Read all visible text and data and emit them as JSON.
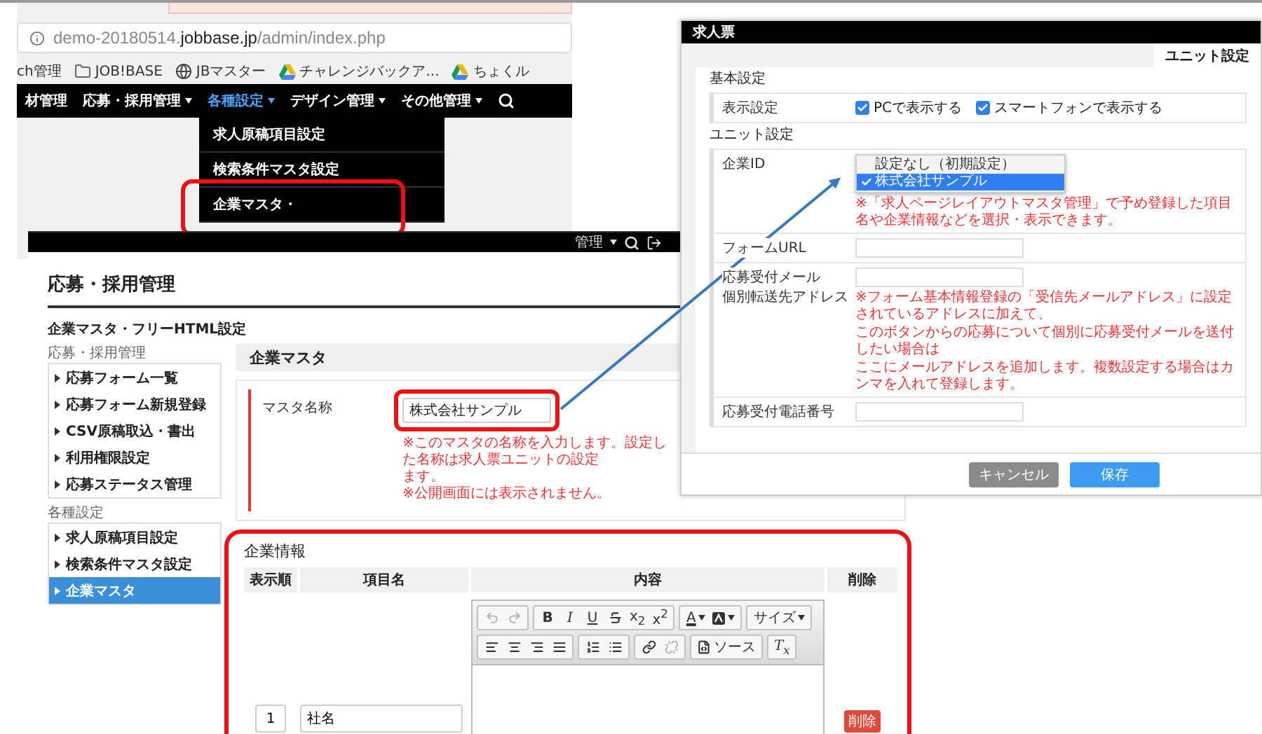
{
  "browser": {
    "url": "demo-20180514.**jobbase.jp**/admin/index.php",
    "bookmarks": [
      {
        "label": "ch管理",
        "kind": "plain"
      },
      {
        "label": "JOB!BASE",
        "kind": "folder"
      },
      {
        "label": "JBマスター",
        "kind": "site"
      },
      {
        "label": "チャレンジバックア...",
        "kind": "drive"
      },
      {
        "label": "ちょくル",
        "kind": "drive"
      }
    ],
    "nav": [
      {
        "label": "材管理",
        "menu": false,
        "selected": false
      },
      {
        "label": "応募・採用管理",
        "menu": true,
        "selected": false
      },
      {
        "label": "各種設定",
        "menu": true,
        "selected": true
      },
      {
        "label": "デザイン管理",
        "menu": true,
        "selected": false
      },
      {
        "label": "その他管理",
        "menu": true,
        "selected": false
      }
    ],
    "dropdown": [
      {
        "label": "求人原稿項目設定",
        "highlighted": false
      },
      {
        "label": "検索条件マスタ設定",
        "highlighted": false
      },
      {
        "label": "企業マスタ・",
        "highlighted": true
      }
    ]
  },
  "admin": {
    "topbar_label": "管理",
    "page_title": "応募・採用管理",
    "sidebar": {
      "title": "企業マスタ・フリーHTML設定",
      "groups": [
        {
          "label": "応募・採用管理",
          "items": [
            {
              "label": "応募フォーム一覧",
              "selected": false
            },
            {
              "label": "応募フォーム新規登録",
              "selected": false
            },
            {
              "label": "CSV原稿取込・書出",
              "selected": false
            },
            {
              "label": "利用権限設定",
              "selected": false
            },
            {
              "label": "応募ステータス管理",
              "selected": false
            }
          ]
        },
        {
          "label": "各種設定",
          "items": [
            {
              "label": "求人原稿項目設定",
              "selected": false
            },
            {
              "label": "検索条件マスタ設定",
              "selected": false
            },
            {
              "label": "企業マスタ",
              "selected": true
            }
          ]
        }
      ]
    },
    "main": {
      "title": "企業マスタ",
      "master": {
        "label": "マスタ名称",
        "value": "株式会社サンプル",
        "highlighted": true,
        "notes": [
          "※このマスタの名称を入力します。設定した名称は求人票ユニットの設定",
          "ます。",
          "※公開画面には表示されません。"
        ]
      },
      "info": {
        "title": "企業情報",
        "highlighted": true,
        "columns": [
          "表示順",
          "項目名",
          "内容",
          "削除"
        ],
        "rows": [
          {
            "order": "1",
            "name": "社名",
            "delete": "削除"
          }
        ]
      }
    }
  },
  "editor": {
    "toolbar": [
      [
        [
          {
            "disabled": true,
            "menu": false
          },
          {
            "disabled": true,
            "menu": false
          }
        ],
        [
          {
            "label": "B",
            "disabled": false,
            "menu": false
          },
          {
            "label": "I",
            "disabled": false,
            "menu": false
          },
          {
            "label": "U",
            "disabled": false,
            "menu": false
          },
          {
            "disabled": false,
            "menu": false
          },
          {
            "label": "x$_{2}$",
            "disabled": false,
            "menu": false
          },
          {
            "label": "x$^{2}$",
            "disabled": false,
            "menu": false
          }
        ],
        [
          {
            "label": "A",
            "disabled": false,
            "menu": true
          },
          {
            "disabled": false,
            "menu": true
          }
        ],
        [
          {
            "label": "サイズ",
            "disabled": false,
            "menu": true
          }
        ]
      ],
      [
        [
          {
            "disabled": false,
            "menu": false
          },
          {
            "disabled": false,
            "menu": false
          },
          {
            "disabled": false,
            "menu": false
          },
          {
            "disabled": false,
            "menu": false
          }
        ],
        [
          {
            "disabled": false,
            "menu": false
          },
          {
            "disabled": false,
            "menu": false
          }
        ],
        [
          {
            "disabled": false,
            "menu": false
          },
          {
            "disabled": true,
            "menu": false
          }
        ],
        [
          {
            "label": "ソース",
            "disabled": false,
            "menu": false
          }
        ],
        [
          {
            "label": "T$_{x}$",
            "disabled": false,
            "menu": false
          }
        ]
      ]
    ]
  },
  "modal": {
    "title": "求人票",
    "tabs": [
      {
        "label": "ユニット設定",
        "selected": true
      }
    ],
    "sections": [
      {
        "title": "基本設定",
        "rows": [
          {
            "kind": "checkboxes",
            "label": "表示設定",
            "options": [
              {
                "label": "PCで表示する",
                "checked": true
              },
              {
                "label": "スマートフォンで表示する",
                "checked": true
              }
            ]
          }
        ]
      },
      {
        "title": "ユニット設定",
        "rows": [
          {
            "kind": "select",
            "label": "企業ID",
            "options": [
              {
                "label": "設定なし（初期設定）",
                "selected": false
              },
              {
                "label": "株式会社サンプル",
                "selected": true
              }
            ],
            "notes": [
              "※「求人ページレイアウトマスタ管理」で予め登録した項目名や企業情報などを選択・表示できます。"
            ]
          },
          {
            "kind": "input",
            "label": "フォームURL",
            "notes": []
          },
          {
            "kind": "input",
            "label_lines": [
              "応募受付メール",
              "個別転送先アドレス"
            ],
            "notes": [
              "※フォーム基本情報登録の「受信先メールアドレス」に設定されているアドレスに加えて、",
              "このボタンからの応募について個別に応募受付メールを送付したい場合は",
              "ここにメールアドレスを追加します。複数設定する場合はカンマを入れて登録します。"
            ]
          },
          {
            "kind": "input",
            "label": "応募受付電話番号",
            "notes": []
          }
        ]
      }
    ],
    "buttons": [
      {
        "label": "キャンセル",
        "kind": "secondary"
      },
      {
        "label": "保存",
        "kind": "primary"
      }
    ]
  }
}
